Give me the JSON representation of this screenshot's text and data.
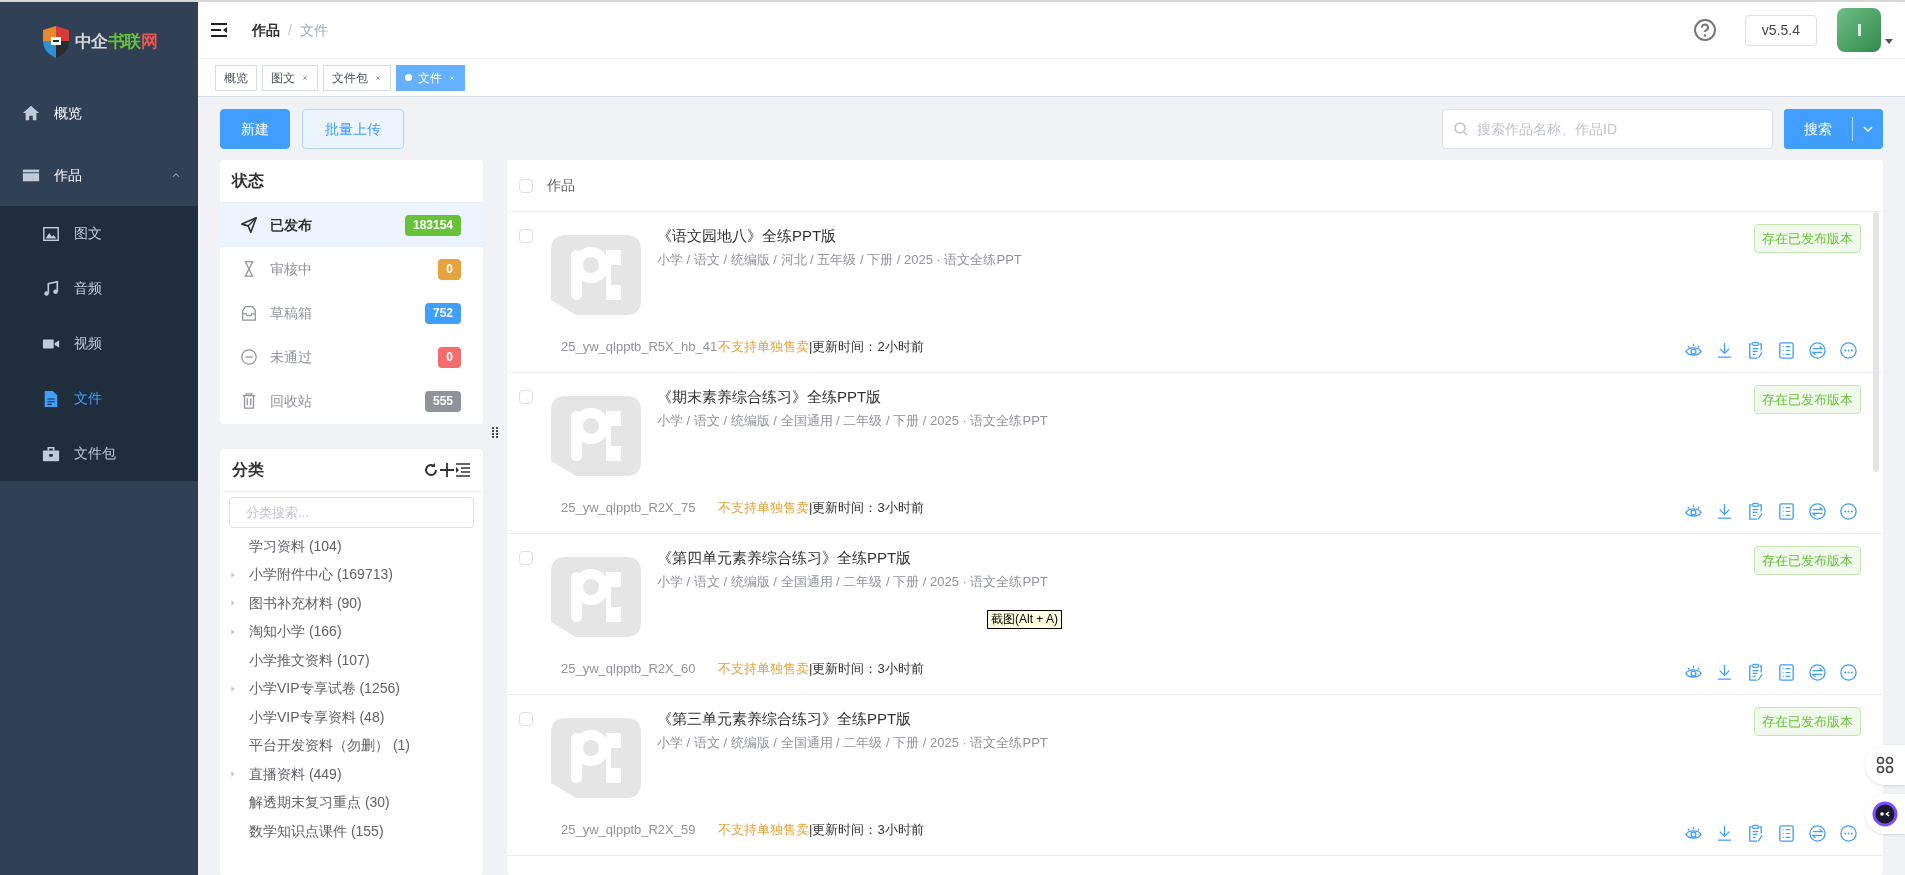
{
  "logo": {
    "parts": [
      {
        "text": "中企",
        "color": "#d9d9d9"
      },
      {
        "text": "书联",
        "color": "#6abf3a"
      },
      {
        "text": "网",
        "color": "#e8554e"
      }
    ]
  },
  "sidebar": {
    "items": [
      {
        "label": "概览",
        "selected": false
      },
      {
        "label": "作品",
        "selected": false,
        "expanded": true,
        "children": [
          {
            "label": "图文",
            "selected": false
          },
          {
            "label": "音频",
            "selected": false
          },
          {
            "label": "视频",
            "selected": false
          },
          {
            "label": "文件",
            "selected": true
          },
          {
            "label": "文件包",
            "selected": false
          }
        ]
      }
    ]
  },
  "breadcrumb": {
    "items": [
      "作品",
      "文件"
    ],
    "separator": "/"
  },
  "version": "v5.5.4",
  "tabs": [
    {
      "label": "概览",
      "closable": false,
      "selected": false
    },
    {
      "label": "图文",
      "closable": true,
      "selected": false
    },
    {
      "label": "文件包",
      "closable": true,
      "selected": false
    },
    {
      "label": "文件",
      "closable": true,
      "selected": true
    }
  ],
  "toolbar": {
    "buttons": [
      {
        "label": "新建",
        "kind": "primary"
      },
      {
        "label": "批量上传",
        "kind": "plain"
      }
    ],
    "search": {
      "placeholder": "搜索作品名称、作品ID"
    },
    "search_button": "搜索"
  },
  "status_panel": {
    "title": "状态",
    "items": [
      {
        "label": "已发布",
        "count": "183154",
        "color": "#67c23a",
        "selected": true
      },
      {
        "label": "审核中",
        "count": "0",
        "color": "#e6a23c",
        "selected": false
      },
      {
        "label": "草稿箱",
        "count": "752",
        "color": "#409eff",
        "selected": false
      },
      {
        "label": "未通过",
        "count": "0",
        "color": "#f56c6c",
        "selected": false
      },
      {
        "label": "回收站",
        "count": "555",
        "color": "#909399",
        "selected": false
      }
    ]
  },
  "category_panel": {
    "title": "分类",
    "search": {
      "placeholder": "分类搜索..."
    },
    "items": [
      {
        "label": "学习资料 (104)",
        "kind": "leaf"
      },
      {
        "label": "小学附件中心 (169713)",
        "kind": "branch"
      },
      {
        "label": "图书补充材料 (90)",
        "kind": "branch"
      },
      {
        "label": "淘知小学 (166)",
        "kind": "branch"
      },
      {
        "label": "小学推文资料 (107)",
        "kind": "leaf"
      },
      {
        "label": "小学VIP专享试卷 (1256)",
        "kind": "branch"
      },
      {
        "label": "小学VIP专享资料 (48)",
        "kind": "leaf"
      },
      {
        "label": "平台开发资料（勿删） (1)",
        "kind": "leaf"
      },
      {
        "label": "直播资料 (449)",
        "kind": "branch"
      },
      {
        "label": "解透期末复习重点 (30)",
        "kind": "leaf"
      },
      {
        "label": "数学知识点课件 (155)",
        "kind": "leaf"
      }
    ]
  },
  "works": {
    "header": "作品",
    "header_checked": false,
    "rows": [
      {
        "title": "《语文园地八》全练PPT版",
        "path": "小学 / 语文 / 统编版 / 河北 / 五年级 / 下册 / 2025 · 语文全练PPT",
        "code": "25_yw_qlpptb_R5X_hb_41",
        "sale_note": "不支持单独售卖",
        "updated": "|更新时间：2小时前",
        "badge": "存在已发布版本",
        "checked": false
      },
      {
        "title": "《期末素养综合练习》全练PPT版",
        "path": "小学 / 语文 / 统编版 / 全国通用 / 二年级 / 下册 / 2025 · 语文全练PPT",
        "code": "25_yw_qlpptb_R2X_75",
        "sale_note": "不支持单独售卖",
        "updated": "|更新时间：3小时前",
        "badge": "存在已发布版本",
        "checked": false
      },
      {
        "title": "《第四单元素养综合练习》全练PPT版",
        "path": "小学 / 语文 / 统编版 / 全国通用 / 二年级 / 下册 / 2025 · 语文全练PPT",
        "code": "25_yw_qlpptb_R2X_60",
        "sale_note": "不支持单独售卖",
        "updated": "|更新时间：3小时前",
        "badge": "存在已发布版本",
        "checked": false
      },
      {
        "title": "《第三单元素养综合练习》全练PPT版",
        "path": "小学 / 语文 / 统编版 / 全国通用 / 二年级 / 下册 / 2025 · 语文全练PPT",
        "code": "25_yw_qlpptb_R2X_59",
        "sale_note": "不支持单独售卖",
        "updated": "|更新时间：3小时前",
        "badge": "存在已发布版本",
        "checked": false
      }
    ]
  },
  "tooltip": "截图(Alt + A)"
}
